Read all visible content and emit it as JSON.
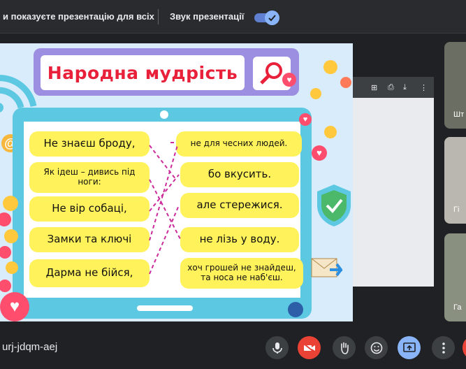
{
  "banner": {
    "message": "и показуєте презентацію для всіх",
    "sound_label": "Звук презентації",
    "sound_on": true
  },
  "slide": {
    "title": "Народна мудрість",
    "left_items": [
      "Не знаєш броду,",
      "Як ідеш – дивись під ноги:",
      "Не вір собаці,",
      "Замки та ключі",
      "Дарма не бійся,"
    ],
    "right_items": [
      "не для чесних людей.",
      "бо вкусить.",
      "але стережися.",
      "не лізь у воду.",
      "хоч грошей не знайдеш, та носа не наб'єш."
    ]
  },
  "participants": [
    "Шт",
    "Гі",
    "Га"
  ],
  "toolbar": {
    "meeting_code": "urj-jdqm-aej",
    "buttons": [
      "microphone-icon",
      "camera-off-icon",
      "raise-hand-icon",
      "emoji-icon",
      "present-icon",
      "more-icon",
      "end-call-icon"
    ]
  }
}
